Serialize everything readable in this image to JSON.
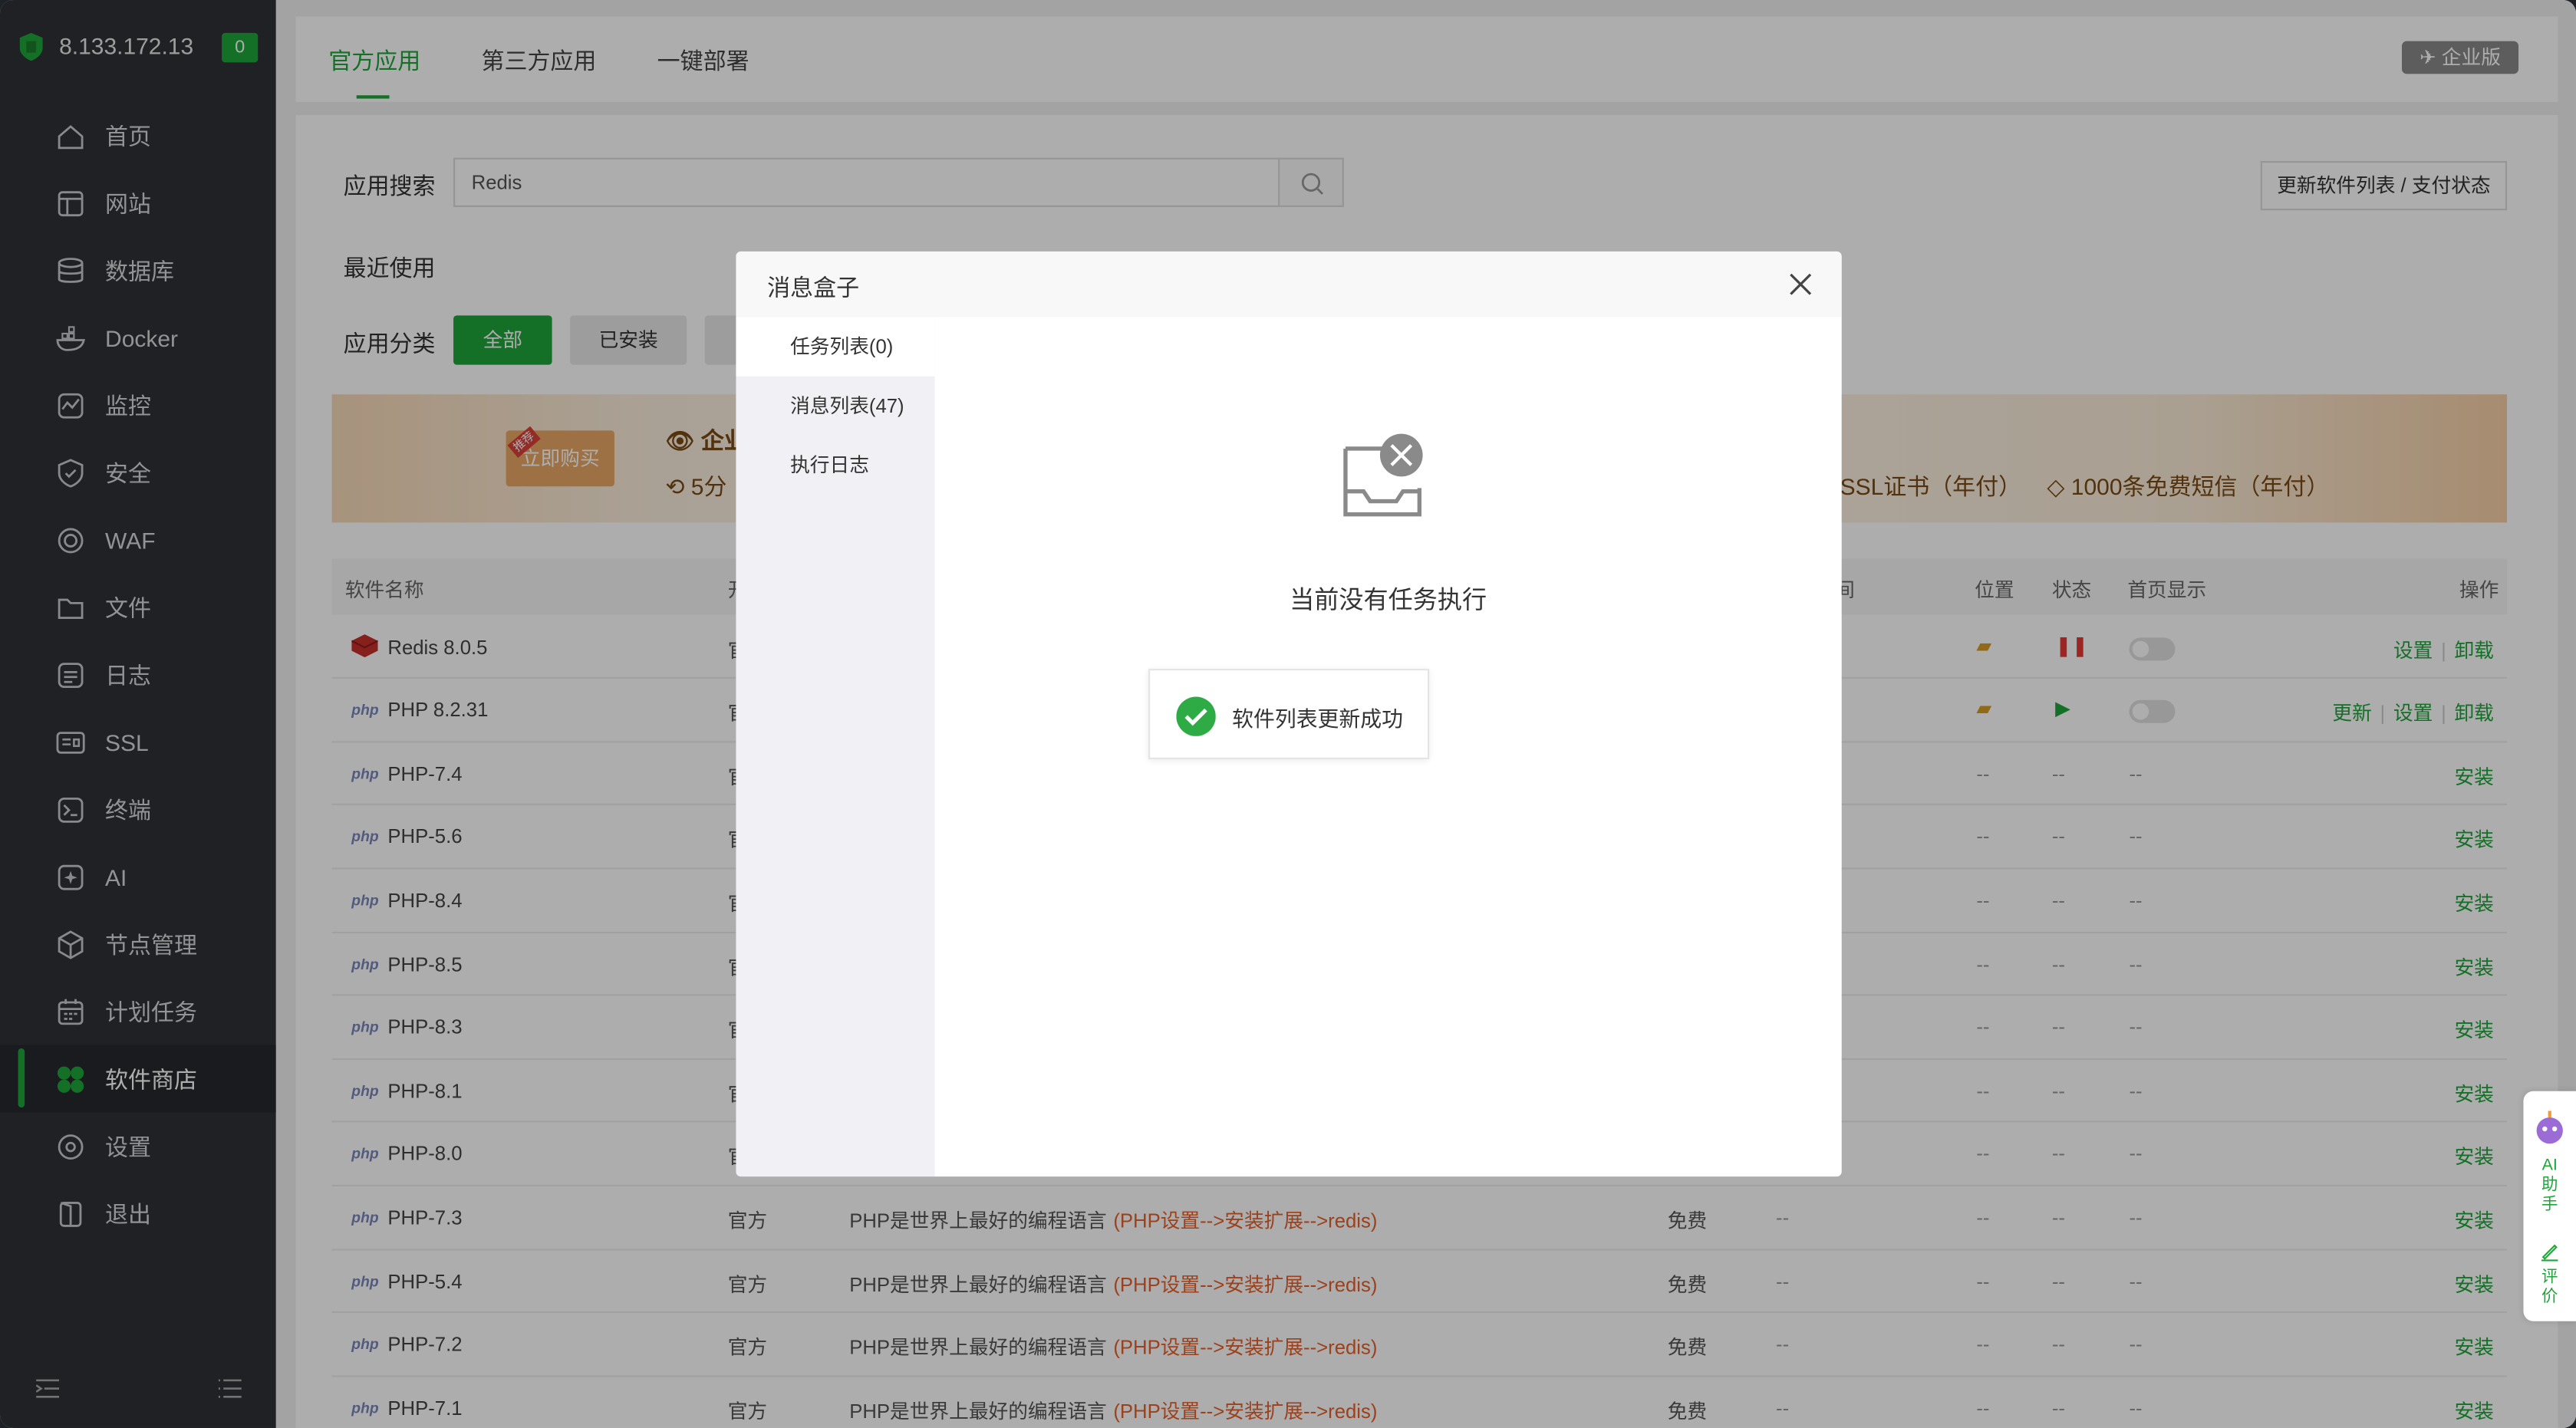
{
  "sidebar": {
    "ip": "8.133.172.13",
    "badge": "0",
    "items": [
      {
        "label": "首页",
        "icon": "home-icon"
      },
      {
        "label": "网站",
        "icon": "website-icon"
      },
      {
        "label": "数据库",
        "icon": "database-icon"
      },
      {
        "label": "Docker",
        "icon": "docker-icon"
      },
      {
        "label": "监控",
        "icon": "monitor-icon"
      },
      {
        "label": "安全",
        "icon": "shield-icon"
      },
      {
        "label": "WAF",
        "icon": "waf-icon"
      },
      {
        "label": "文件",
        "icon": "folder-icon"
      },
      {
        "label": "日志",
        "icon": "log-icon"
      },
      {
        "label": "SSL",
        "icon": "ssl-icon"
      },
      {
        "label": "终端",
        "icon": "terminal-icon"
      },
      {
        "label": "AI",
        "icon": "ai-icon"
      },
      {
        "label": "节点管理",
        "icon": "node-icon"
      },
      {
        "label": "计划任务",
        "icon": "calendar-icon"
      },
      {
        "label": "软件商店",
        "icon": "store-icon",
        "active": true
      },
      {
        "label": "设置",
        "icon": "gear-icon"
      },
      {
        "label": "退出",
        "icon": "logout-icon"
      }
    ]
  },
  "tabs": [
    "官方应用",
    "第三方应用",
    "一键部署"
  ],
  "enterprise_badge": "企业版",
  "search": {
    "label": "应用搜索",
    "value": "Redis"
  },
  "update_button": "更新软件列表 / 支付状态",
  "recent_label": "最近使用",
  "category": {
    "label": "应用分类",
    "all": "全部",
    "installed": "已安装"
  },
  "banner": {
    "buy": "立即购买",
    "tag": "推荐",
    "t1": "企业",
    "t2": "5分",
    "t3": "SSL证书（年付）",
    "t4": "1000条免费短信（年付）"
  },
  "table": {
    "headers": {
      "name": "软件名称",
      "dev": "开",
      "expire": "间",
      "location": "位置",
      "status": "状态",
      "homepage": "首页显示",
      "ops": "操作"
    },
    "rows": [
      {
        "name": "Redis 8.0.5",
        "dev": "官",
        "desc": "",
        "desc_o": "",
        "price": "",
        "expire": "",
        "type": "redis",
        "ops": [
          "设置",
          "卸载"
        ]
      },
      {
        "name": "PHP 8.2.31",
        "dev": "官",
        "desc": "",
        "desc_o": "",
        "price": "",
        "expire": "",
        "type": "php",
        "ops": [
          "更新",
          "设置",
          "卸载"
        ]
      },
      {
        "name": "PHP-7.4",
        "dev": "官",
        "desc": "",
        "desc_o": "",
        "price": "",
        "expire": "",
        "type": "php",
        "ops": [
          "安装"
        ]
      },
      {
        "name": "PHP-5.6",
        "dev": "官",
        "desc": "",
        "desc_o": "",
        "price": "",
        "expire": "",
        "type": "php",
        "ops": [
          "安装"
        ]
      },
      {
        "name": "PHP-8.4",
        "dev": "官",
        "desc": "",
        "desc_o": "",
        "price": "",
        "expire": "",
        "type": "php",
        "ops": [
          "安装"
        ]
      },
      {
        "name": "PHP-8.5",
        "dev": "官",
        "desc": "",
        "desc_o": "",
        "price": "",
        "expire": "",
        "type": "php",
        "ops": [
          "安装"
        ]
      },
      {
        "name": "PHP-8.3",
        "dev": "官",
        "desc": "",
        "desc_o": "",
        "price": "",
        "expire": "",
        "type": "php",
        "ops": [
          "安装"
        ]
      },
      {
        "name": "PHP-8.1",
        "dev": "官",
        "desc": "",
        "desc_o": "",
        "price": "",
        "expire": "",
        "type": "php",
        "ops": [
          "安装"
        ]
      },
      {
        "name": "PHP-8.0",
        "dev": "官",
        "desc": "",
        "desc_o": "",
        "price": "",
        "expire": "",
        "type": "php",
        "ops": [
          "安装"
        ]
      },
      {
        "name": "PHP-7.3",
        "dev": "官方",
        "desc": "PHP是世界上最好的编程语言",
        "desc_o": "(PHP设置-->安装扩展-->redis)",
        "price": "免费",
        "expire": "--",
        "type": "php",
        "ops": [
          "安装"
        ]
      },
      {
        "name": "PHP-5.4",
        "dev": "官方",
        "desc": "PHP是世界上最好的编程语言",
        "desc_o": "(PHP设置-->安装扩展-->redis)",
        "price": "免费",
        "expire": "--",
        "type": "php",
        "ops": [
          "安装"
        ]
      },
      {
        "name": "PHP-7.2",
        "dev": "官方",
        "desc": "PHP是世界上最好的编程语言",
        "desc_o": "(PHP设置-->安装扩展-->redis)",
        "price": "免费",
        "expire": "--",
        "type": "php",
        "ops": [
          "安装"
        ]
      },
      {
        "name": "PHP-7.1",
        "dev": "官方",
        "desc": "PHP是世界上最好的编程语言",
        "desc_o": "(PHP设置-->安装扩展-->redis)",
        "price": "免费",
        "expire": "--",
        "type": "php",
        "ops": [
          "安装"
        ]
      }
    ]
  },
  "modal": {
    "title": "消息盒子",
    "tabs": [
      "任务列表(0)",
      "消息列表(47)",
      "执行日志"
    ],
    "empty_text": "当前没有任务执行",
    "toast": "软件列表更新成功"
  },
  "ai_widget": {
    "ai_label": "AI助手",
    "review_label": "评价"
  },
  "colors": {
    "accent": "#20a53a",
    "sidebar": "#2f3237",
    "orange": "#e6602a"
  }
}
